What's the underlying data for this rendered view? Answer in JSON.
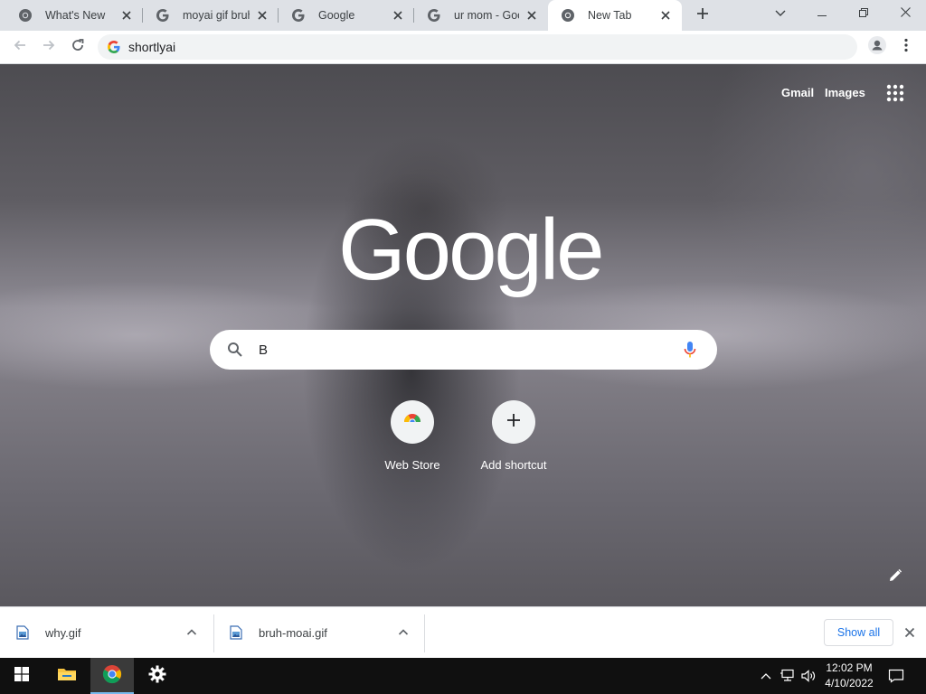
{
  "tabs": [
    {
      "title": "What's New",
      "favicon": "chrome-icon",
      "active": false
    },
    {
      "title": "moyai gif bruhh",
      "favicon": "google-g-icon",
      "active": false
    },
    {
      "title": "Google",
      "favicon": "google-g-icon",
      "active": false
    },
    {
      "title": "ur mom - Goog",
      "favicon": "google-g-icon",
      "active": false
    },
    {
      "title": "New Tab",
      "favicon": "chrome-icon",
      "active": true
    }
  ],
  "toolbar": {
    "url": "shortlyai"
  },
  "ntp": {
    "gmail_label": "Gmail",
    "images_label": "Images",
    "logo_text": "Google",
    "search_value": "B",
    "shortcuts": [
      {
        "label": "Web Store",
        "icon": "web-store-icon"
      },
      {
        "label": "Add shortcut",
        "icon": "plus-icon"
      }
    ]
  },
  "downloads": {
    "items": [
      {
        "filename": "why.gif"
      },
      {
        "filename": "bruh-moai.gif"
      }
    ],
    "show_all_label": "Show all"
  },
  "taskbar": {
    "time": "12:02 PM",
    "date": "4/10/2022"
  },
  "colors": {
    "tabstrip": "#dee1e6",
    "link_blue": "#1a73e8",
    "taskbar": "#101010"
  }
}
